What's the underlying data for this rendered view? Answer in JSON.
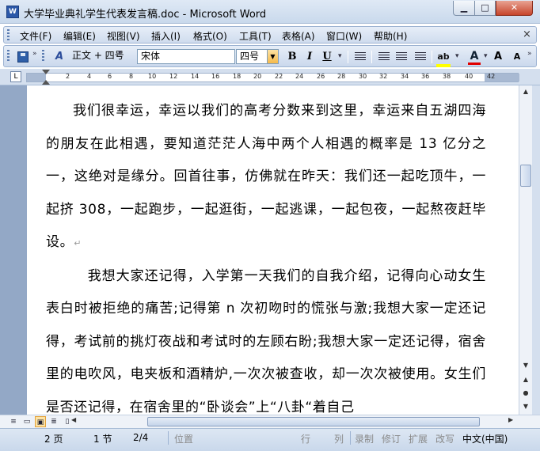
{
  "window": {
    "title": "大学毕业典礼学生代表发言稿.doc - Microsoft Word",
    "app_icon": "W",
    "minimize": "▁",
    "maximize": "□",
    "close": "✕"
  },
  "menubar": {
    "items": [
      "文件(F)",
      "编辑(E)",
      "视图(V)",
      "插入(I)",
      "格式(O)",
      "工具(T)",
      "表格(A)",
      "窗口(W)",
      "帮助(H)"
    ],
    "close_doc": "×"
  },
  "toolbar": {
    "style_value": "正文 + 四号",
    "font_value": "宋体",
    "size_value": "四号",
    "bold": "B",
    "italic": "I",
    "underline": "U",
    "styles_icon": "A",
    "highlight_label": "ab",
    "font_color_label": "A",
    "grow_font": "A",
    "shrink_font": "A",
    "highlight_color": "#ffff00",
    "font_color": "#e00000"
  },
  "ruler": {
    "ticks": [
      "2",
      "2",
      "4",
      "6",
      "8",
      "10",
      "12",
      "14",
      "16",
      "18",
      "20",
      "22",
      "24",
      "26",
      "28",
      "30",
      "32",
      "34",
      "36",
      "38",
      "40",
      "42"
    ],
    "corner": "L"
  },
  "document": {
    "paragraphs": [
      "我们很幸运，幸运以我们的高考分数来到这里，幸运来自五湖四海的朋友在此相遇，要知道茫茫人海中两个人相遇的概率是 13 亿分之一，这绝对是缘分。回首往事，仿佛就在昨天：我们还一起吃顶牛，一起挤 308，一起跑步，一起逛街，一起逃课，一起包夜，一起熬夜赶毕设。",
      "我想大家还记得，入学第一天我们的自我介绍，记得向心动女生表白时被拒绝的痛苦;记得第 n 次初吻时的慌张与激;我想大家一定还记得，考试前的挑灯夜战和考试时的左顾右盼;我想大家一定还记得，宿舍里的电吹风，电夹板和酒精炉,一次次被查收，却一次次被使用。女生们是否还记得，在宿舍里的“卧谈会”上“八卦“着自己"
    ],
    "para_mark": "↵"
  },
  "statusbar": {
    "page": "2 页",
    "section": "1 节",
    "page_of": "2/4",
    "position": "位置",
    "line": "行",
    "col": "列",
    "rec": "录制",
    "trk": "修订",
    "ext": "扩展",
    "ovr": "改写",
    "lang": "中文(中国)"
  },
  "scrollbar": {
    "up": "▲",
    "down": "▼",
    "prev": "▲",
    "select": "●",
    "next": "▼",
    "left": "◀",
    "right": "▶"
  },
  "views": {
    "normal": "≡",
    "web": "▭",
    "print": "▣",
    "outline": "≣",
    "reading": "▯"
  }
}
